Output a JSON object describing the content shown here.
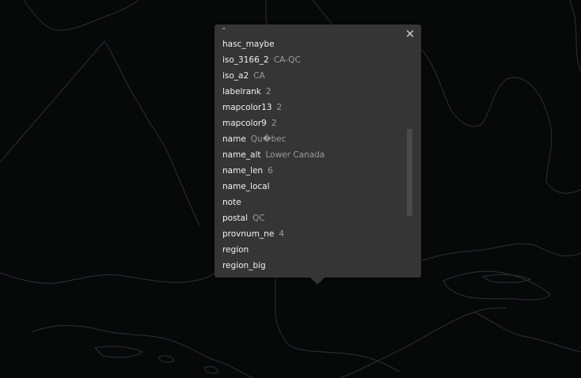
{
  "popup": {
    "close_label": "✕",
    "attributes": [
      {
        "key": "-",
        "value": ""
      },
      {
        "key": "hasc_maybe",
        "value": ""
      },
      {
        "key": "iso_3166_2",
        "value": "CA-QC"
      },
      {
        "key": "iso_a2",
        "value": "CA"
      },
      {
        "key": "labelrank",
        "value": "2"
      },
      {
        "key": "mapcolor13",
        "value": "2"
      },
      {
        "key": "mapcolor9",
        "value": "2"
      },
      {
        "key": "name",
        "value": "Qu�bec"
      },
      {
        "key": "name_alt",
        "value": "Lower Canada"
      },
      {
        "key": "name_len",
        "value": "6"
      },
      {
        "key": "name_local",
        "value": ""
      },
      {
        "key": "note",
        "value": ""
      },
      {
        "key": "postal",
        "value": "QC"
      },
      {
        "key": "provnum_ne",
        "value": "4"
      },
      {
        "key": "region",
        "value": ""
      },
      {
        "key": "region_big",
        "value": ""
      }
    ]
  },
  "colors": {
    "background": "#070808",
    "boundary": "#2b3236",
    "popup": "#353535"
  }
}
